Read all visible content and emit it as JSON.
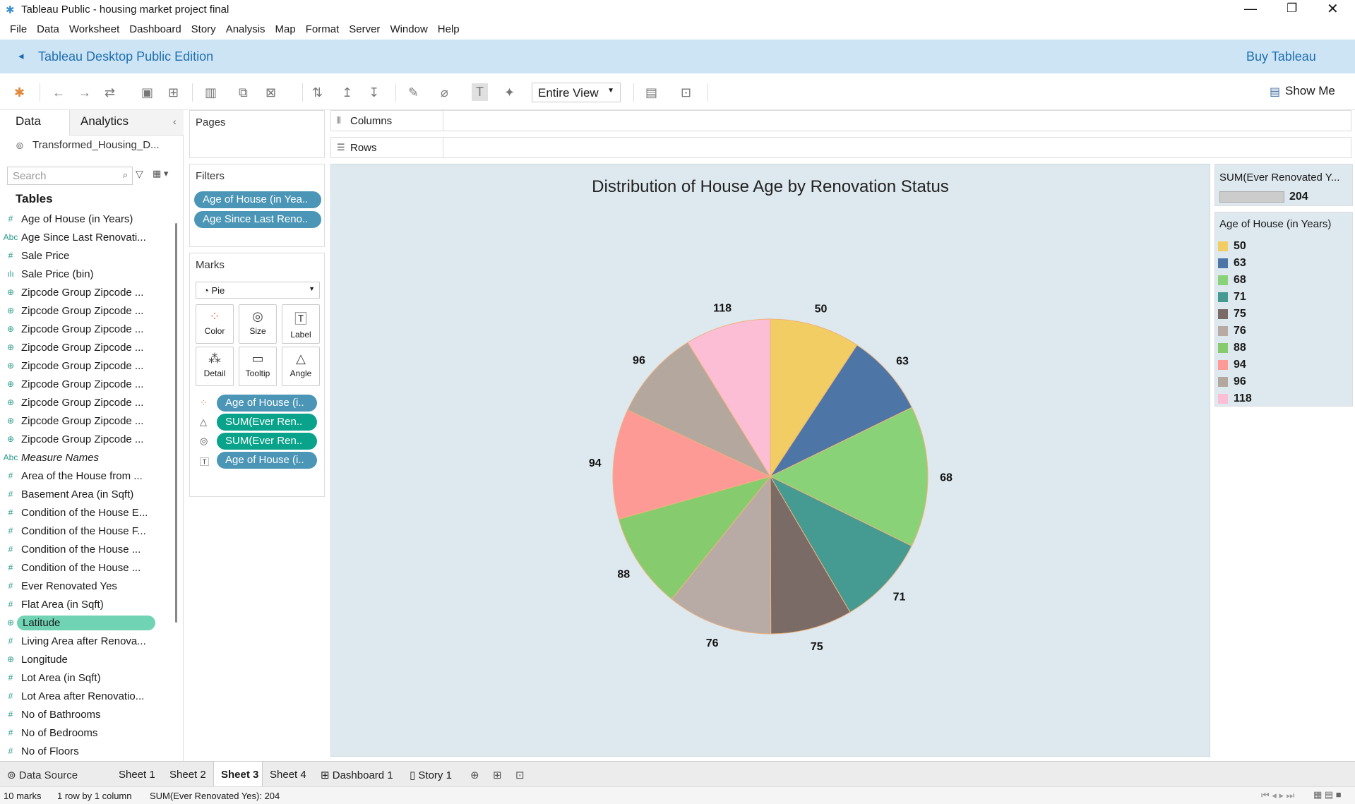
{
  "window": {
    "title": "Tableau Public - housing market project final"
  },
  "menu": [
    "File",
    "Data",
    "Worksheet",
    "Dashboard",
    "Story",
    "Analysis",
    "Map",
    "Format",
    "Server",
    "Window",
    "Help"
  ],
  "banner": {
    "edition": "Tableau Desktop Public Edition",
    "buy": "Buy Tableau"
  },
  "toolbar": {
    "fit": "Entire View",
    "show_me": "Show Me"
  },
  "left": {
    "tab_data": "Data",
    "tab_analytics": "Analytics",
    "datasource": "Transformed_Housing_D...",
    "search_placeholder": "Search",
    "tables_label": "Tables",
    "fields": [
      {
        "icon": "#",
        "name": "Age of House (in Years)"
      },
      {
        "icon": "Abc",
        "name": "Age Since Last Renovati..."
      },
      {
        "icon": "#",
        "name": "Sale Price"
      },
      {
        "icon": "bin",
        "name": "Sale Price (bin)"
      },
      {
        "icon": "geo",
        "name": "Zipcode Group Zipcode ..."
      },
      {
        "icon": "geo",
        "name": "Zipcode Group Zipcode ..."
      },
      {
        "icon": "geo",
        "name": "Zipcode Group Zipcode ..."
      },
      {
        "icon": "geo",
        "name": "Zipcode Group Zipcode ..."
      },
      {
        "icon": "geo",
        "name": "Zipcode Group Zipcode ..."
      },
      {
        "icon": "geo",
        "name": "Zipcode Group Zipcode ..."
      },
      {
        "icon": "geo",
        "name": "Zipcode Group Zipcode ..."
      },
      {
        "icon": "geo",
        "name": "Zipcode Group Zipcode ..."
      },
      {
        "icon": "geo",
        "name": "Zipcode Group Zipcode ..."
      },
      {
        "icon": "Abc",
        "name": "Measure Names"
      },
      {
        "icon": "#",
        "name": "Area of the House from ..."
      },
      {
        "icon": "#",
        "name": "Basement Area (in Sqft)"
      },
      {
        "icon": "#",
        "name": "Condition of the House E..."
      },
      {
        "icon": "#",
        "name": "Condition of the House F..."
      },
      {
        "icon": "#",
        "name": "Condition of the House ..."
      },
      {
        "icon": "#",
        "name": "Condition of the House ..."
      },
      {
        "icon": "#",
        "name": "Ever Renovated Yes"
      },
      {
        "icon": "#",
        "name": "Flat Area (in Sqft)"
      },
      {
        "icon": "geo",
        "name": "Latitude"
      },
      {
        "icon": "#",
        "name": "Living Area after Renova..."
      },
      {
        "icon": "geo",
        "name": "Longitude"
      },
      {
        "icon": "#",
        "name": "Lot Area (in Sqft)"
      },
      {
        "icon": "#",
        "name": "Lot Area after Renovatio..."
      },
      {
        "icon": "#",
        "name": "No of Bathrooms"
      },
      {
        "icon": "#",
        "name": "No of Bedrooms"
      },
      {
        "icon": "#",
        "name": "No of Floors"
      }
    ]
  },
  "cards": {
    "pages": "Pages",
    "filters": "Filters",
    "filter_pills": [
      "Age of House (in Yea..",
      "Age Since Last Reno.."
    ],
    "marks": "Marks",
    "mark_type": "Pie",
    "mark_buttons": [
      "Color",
      "Size",
      "Label",
      "Detail",
      "Tooltip",
      "Angle"
    ],
    "mark_pills": [
      "Age of House (i..",
      "SUM(Ever Ren..",
      "SUM(Ever Ren..",
      "Age of House (i.."
    ]
  },
  "shelves": {
    "columns": "Columns",
    "rows": "Rows"
  },
  "chart_data": {
    "type": "pie",
    "title": "Distribution of House Age by Renovation Status",
    "categories": [
      "50",
      "63",
      "68",
      "71",
      "75",
      "76",
      "88",
      "94",
      "96",
      "118"
    ],
    "values": [
      9.6,
      8.8,
      15.0,
      9.6,
      8.7,
      11.2,
      10.2,
      11.7,
      9.6,
      9.1
    ],
    "colors": [
      "#f1cd63",
      "#4d76a6",
      "#8ad277",
      "#459a92",
      "#7a6b67",
      "#b8aba6",
      "#86cc6e",
      "#fe9a96",
      "#b4a79e",
      "#fbbed5"
    ]
  },
  "legend": {
    "sum_title": "SUM(Ever Renovated Y...",
    "sum_value": "204",
    "color_title": "Age of House (in Years)"
  },
  "tabs": [
    "Data Source",
    "Sheet 1",
    "Sheet 2",
    "Sheet 3",
    "Sheet 4",
    "Dashboard 1",
    "Story 1"
  ],
  "status": {
    "marks": "10 marks",
    "dims": "1 row by 1 column",
    "sum": "SUM(Ever Renovated Yes): 204"
  }
}
